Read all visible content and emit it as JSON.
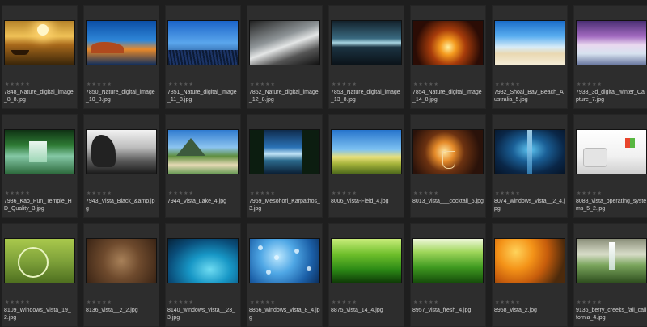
{
  "rating_stars": "★★★★★",
  "items": [
    {
      "filename": "7848_Nature_digital_image_8_8.jpg",
      "thumb": "sunset-lake"
    },
    {
      "filename": "7850_Nature_digital_image_10_8.jpg",
      "thumb": "red-rock-coast"
    },
    {
      "filename": "7851_Nature_digital_image_11_8.jpg",
      "thumb": "blue-sky-reeds"
    },
    {
      "filename": "7852_Nature_digital_image_12_8.jpg",
      "thumb": "bw-ocean-wave"
    },
    {
      "filename": "7853_Nature_digital_image_13_8.jpg",
      "thumb": "misty-sea"
    },
    {
      "filename": "7854_Nature_digital_image_14_8.jpg",
      "thumb": "fire-glow"
    },
    {
      "filename": "7932_Shoal_Bay_Beach_Australia_5.jpg",
      "thumb": "beach"
    },
    {
      "filename": "7933_3d_digital_winter_Capture_7.jpg",
      "thumb": "winter-purple"
    },
    {
      "filename": "7936_Kao_Pun_Temple_HD_Quality_3.jpg",
      "thumb": "waterfall-temple"
    },
    {
      "filename": "7943_Vista_Black_&amp.jpg",
      "thumb": "bw-tree"
    },
    {
      "filename": "7944_Vista_Lake_4.jpg",
      "thumb": "lake-mountains"
    },
    {
      "filename": "7969_Mesohori_Karpathos_3.jpg",
      "thumb": "coastal-trees"
    },
    {
      "filename": "8006_Vista-Field_4.jpg",
      "thumb": "green-field"
    },
    {
      "filename": "8013_vista___cocktail_6.jpg",
      "thumb": "cocktail-glasses"
    },
    {
      "filename": "8074_windows_vista__2_4.jpg",
      "thumb": "blue-beam"
    },
    {
      "filename": "8088_vista_operating_systems_5_2.jpg",
      "thumb": "white-room-logo"
    },
    {
      "filename": "8109_Windows_Vista_19_2.jpg",
      "thumb": "crop-circle"
    },
    {
      "filename": "8136_vista__2_2.jpg",
      "thumb": "brown-abstract"
    },
    {
      "filename": "8140_windows_vista__23_3.jpg",
      "thumb": "underwater-orb"
    },
    {
      "filename": "8866_windows_vista_8_4.jpg",
      "thumb": "water-drops"
    },
    {
      "filename": "8875_vista_14_4.jpg",
      "thumb": "grass-closeup"
    },
    {
      "filename": "8957_vista_fresh_4.jpg",
      "thumb": "fresh-grass"
    },
    {
      "filename": "8958_vista_2.jpg",
      "thumb": "orange-flowers"
    },
    {
      "filename": "9136_berry_creeks_fall_california_4.jpg",
      "thumb": "forest-waterfall"
    }
  ]
}
